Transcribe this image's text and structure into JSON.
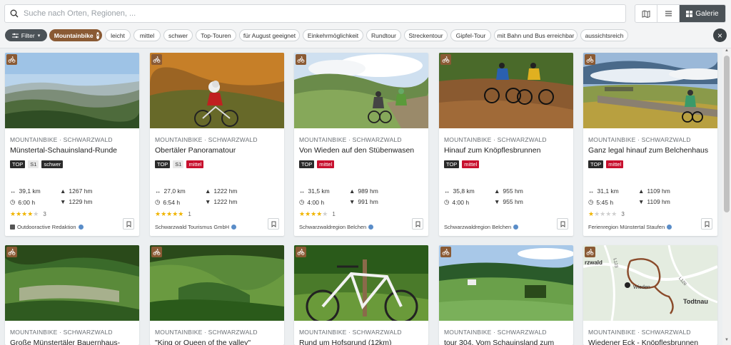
{
  "search": {
    "placeholder": "Suche nach Orten, Regionen, ..."
  },
  "views": {
    "gallery_label": "Galerie"
  },
  "filters": {
    "filter_label": "Filter",
    "active": "Mountainbike",
    "chips": [
      "leicht",
      "mittel",
      "schwer",
      "Top-Touren",
      "für August geeignet",
      "Einkehrmöglichkeit",
      "Rundtour",
      "Streckentour",
      "Gipfel-Tour",
      "mit Bahn und Bus erreichbar",
      "aussichtsreich"
    ]
  },
  "colors": {
    "accent_brown": "#8a5a34",
    "mittel_red": "#c8102e",
    "dark": "#4b5257"
  },
  "cards": [
    {
      "category": "MOUNTAINBIKE · SCHWARZWALD",
      "title": "Münstertal-Schauinsland-Runde",
      "tags": [
        "TOP",
        "S1",
        "schwer"
      ],
      "distance": "39,1 km",
      "ascent": "1267 hm",
      "duration": "6:00 h",
      "descent": "1229 hm",
      "rating": 4,
      "reviews": "3",
      "source": "Outdooractive Redaktion"
    },
    {
      "category": "MOUNTAINBIKE · SCHWARZWALD",
      "title": "Obertäler Panoramatour",
      "tags": [
        "TOP",
        "S1",
        "mittel"
      ],
      "distance": "27,0 km",
      "ascent": "1222 hm",
      "duration": "6:54 h",
      "descent": "1222 hm",
      "rating": 5,
      "reviews": "1",
      "source": "Schwarzwald Tourismus GmbH"
    },
    {
      "category": "MOUNTAINBIKE · SCHWARZWALD",
      "title": "Von Wieden auf den Stübenwasen",
      "tags": [
        "TOP",
        "mittel"
      ],
      "distance": "31,5 km",
      "ascent": "989 hm",
      "duration": "4:00 h",
      "descent": "991 hm",
      "rating": 4,
      "reviews": "1",
      "source": "Schwarzwaldregion Belchen"
    },
    {
      "category": "MOUNTAINBIKE · SCHWARZWALD",
      "title": "Hinauf zum Knöpflesbrunnen",
      "tags": [
        "TOP",
        "mittel"
      ],
      "distance": "35,8 km",
      "ascent": "955 hm",
      "duration": "4:00 h",
      "descent": "955 hm",
      "rating": 0,
      "reviews": "",
      "source": "Schwarzwaldregion Belchen"
    },
    {
      "category": "MOUNTAINBIKE · SCHWARZWALD",
      "title": "Ganz legal hinauf zum Belchenhaus",
      "tags": [
        "TOP",
        "mittel"
      ],
      "distance": "31,1 km",
      "ascent": "1109 hm",
      "duration": "5:45 h",
      "descent": "1109 hm",
      "rating": 1,
      "reviews": "3",
      "source": "Ferienregion Münstertal Staufen"
    }
  ],
  "cards_row2": [
    {
      "category": "MOUNTAINBIKE · SCHWARZWALD",
      "title": "Große Münstertäler Bauernhaus-"
    },
    {
      "category": "MOUNTAINBIKE · SCHWARZWALD",
      "title": "\"King or Queen of the valley\""
    },
    {
      "category": "MOUNTAINBIKE · SCHWARZWALD",
      "title": "Rund um Hofsgrund (12km)"
    },
    {
      "category": "MOUNTAINBIKE · SCHWARZWALD",
      "title": "tour 304. Vom Schauinsland zum"
    },
    {
      "category": "MOUNTAINBIKE · SCHWARZWALD",
      "title": "Wiedener Eck - Knöpflesbrunnen"
    }
  ],
  "map_labels": {
    "a": "rzwald",
    "b": "Wieden",
    "c": "Todtnau",
    "d": "L123",
    "e": "L126"
  }
}
